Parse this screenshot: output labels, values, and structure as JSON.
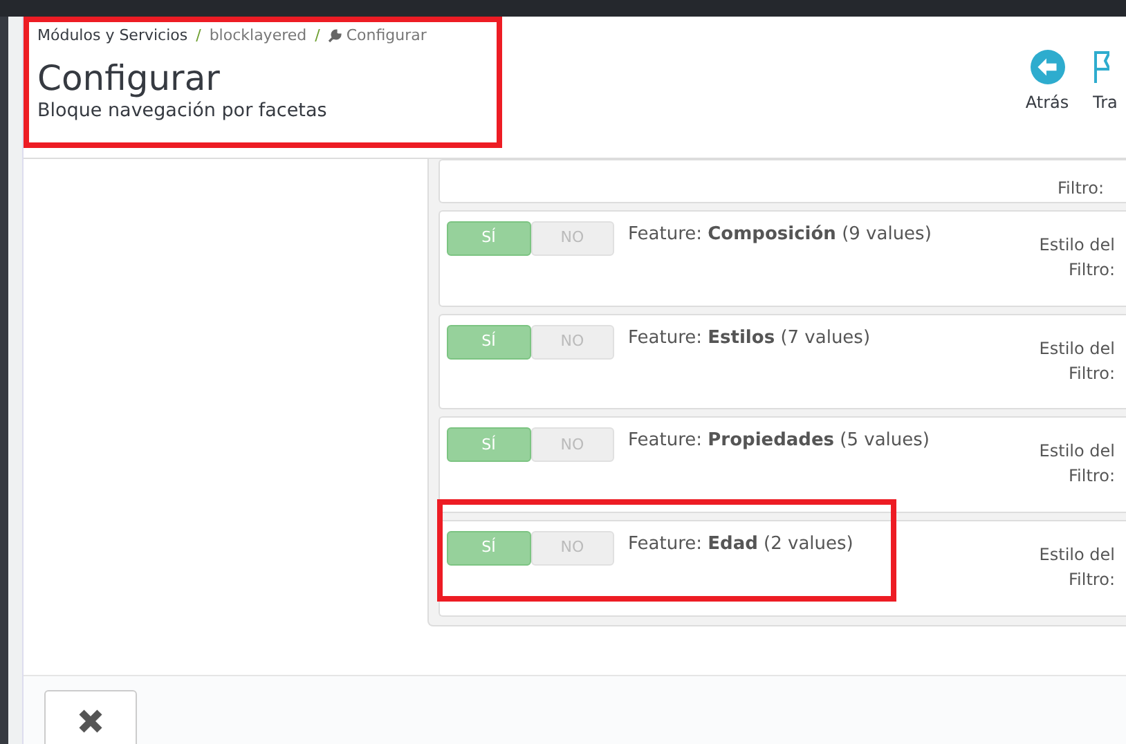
{
  "breadcrumb": [
    {
      "label": "Módulos y Servicios",
      "kind": "link"
    },
    {
      "label": "blocklayered",
      "kind": "link"
    },
    {
      "label": "Configurar",
      "kind": "current"
    }
  ],
  "header": {
    "title": "Configurar",
    "subtitle": "Bloque navegación por facetas",
    "highlighted": true
  },
  "breadcrumb_separator": "/",
  "toolbar": [
    {
      "label": "Atrás",
      "kind": "back"
    },
    {
      "label": "Tra",
      "kind": "flag"
    }
  ],
  "cut_filter": {
    "style_label": "Filtro:"
  },
  "filters": [
    {
      "title": "Feature: **Composición** (9 values)",
      "on_label": "SÍ",
      "off_label": "NO",
      "enabled": true,
      "style_label_1": "Estilo del",
      "style_label_2": "Filtro:",
      "highlighted": false
    },
    {
      "title": "Feature: **Estilos** (7 values)",
      "on_label": "SÍ",
      "off_label": "NO",
      "enabled": true,
      "style_label_1": "Estilo del",
      "style_label_2": "Filtro:",
      "highlighted": false
    },
    {
      "title": "Feature: **Propiedades** (5 values)",
      "on_label": "SÍ",
      "off_label": "NO",
      "enabled": true,
      "style_label_1": "Estilo del",
      "style_label_2": "Filtro:",
      "highlighted": false
    },
    {
      "title": "Feature: **Edad** (2 values)",
      "on_label": "SÍ",
      "off_label": "NO",
      "enabled": true,
      "style_label_1": "Estilo del",
      "style_label_2": "Filtro:",
      "highlighted": true
    }
  ],
  "footer": {
    "buttons": [
      {
        "kind": "cancel"
      }
    ]
  }
}
